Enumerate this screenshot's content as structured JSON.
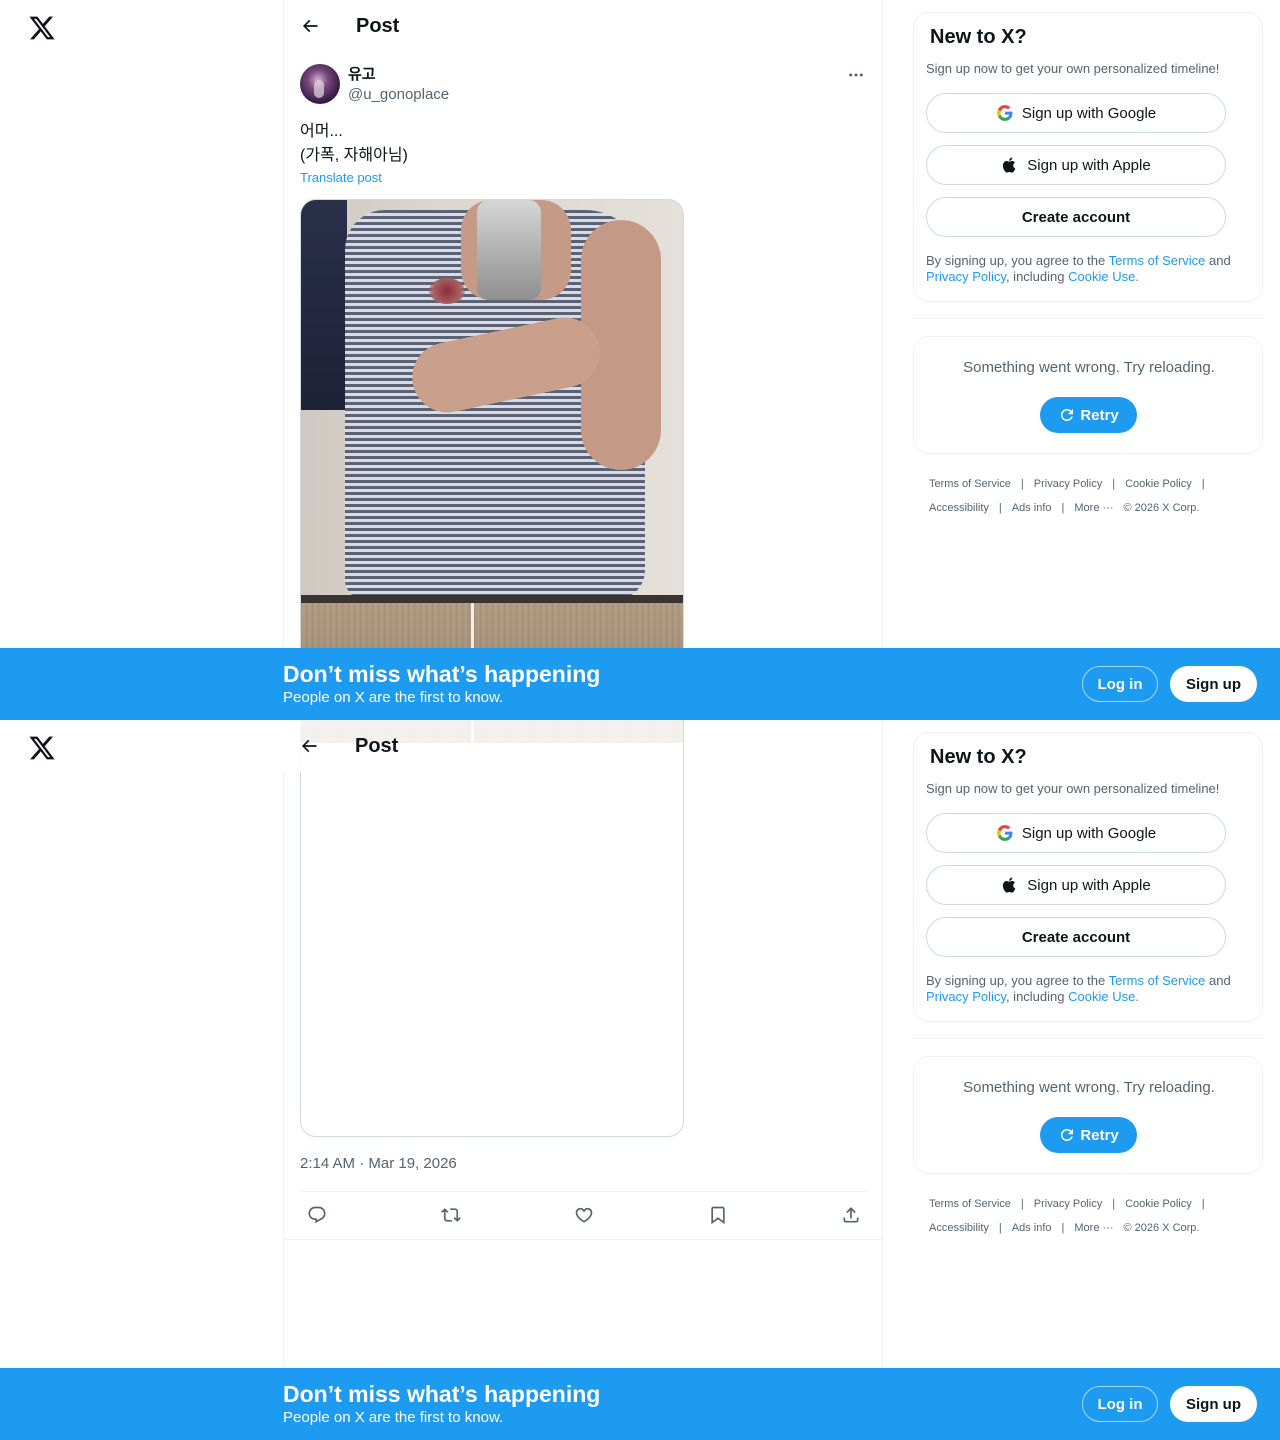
{
  "header": {
    "title": "Post"
  },
  "post": {
    "display_name": "유고",
    "handle": "@u_gonoplace",
    "text_line1": "어머...",
    "text_line2": "(가폭, 자해아님)",
    "translate_label": "Translate post",
    "timestamp": "2:14 AM · Mar 19, 2026"
  },
  "sidebar": {
    "title": "New to X?",
    "subtitle": "Sign up now to get your own personalized timeline!",
    "google_label": "Sign up with Google",
    "apple_label": "Sign up with Apple",
    "create_label": "Create account",
    "terms_prefix": "By signing up, you agree to the ",
    "terms_link": "Terms of Service",
    "terms_and": " and",
    "privacy_link": "Privacy Policy",
    "including": ", including ",
    "cookie_link": "Cookie Use.",
    "error_text": "Something went wrong. Try reloading.",
    "retry_label": "Retry"
  },
  "footer": {
    "links": [
      "Terms of Service",
      "Privacy Policy",
      "Cookie Policy",
      "Accessibility",
      "Ads info",
      "More ···",
      "© 2026 X Corp."
    ]
  },
  "banner": {
    "title": "Don’t miss what’s happening",
    "subtitle": "People on X are the first to know.",
    "login_label": "Log in",
    "signup_label": "Sign up"
  },
  "colors": {
    "accent": "#1d9bf0",
    "text_secondary": "#536471",
    "border": "#eff3f4"
  },
  "icons": [
    "x-logo-icon",
    "back-arrow-icon",
    "more-icon",
    "reply-icon",
    "repost-icon",
    "like-icon",
    "bookmark-icon",
    "share-icon",
    "google-icon",
    "apple-icon",
    "refresh-icon"
  ]
}
